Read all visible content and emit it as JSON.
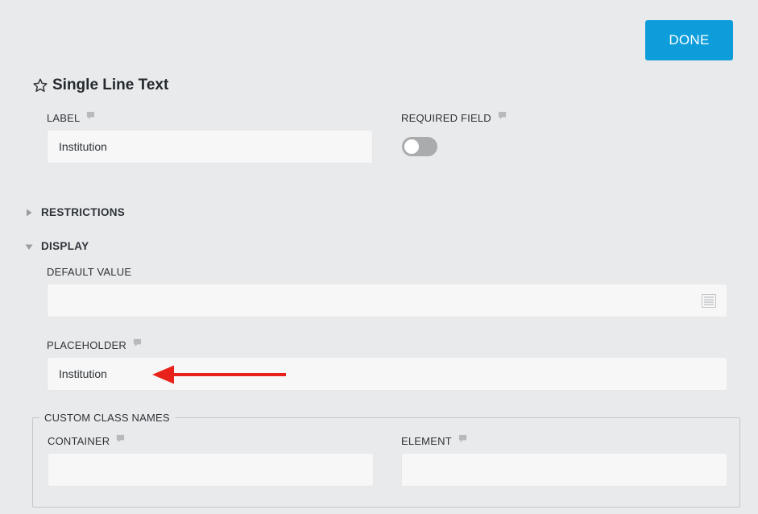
{
  "toolbar": {
    "done_label": "DONE"
  },
  "header": {
    "title": "Single Line Text"
  },
  "fields": {
    "label": {
      "label": "LABEL",
      "value": "Institution"
    },
    "required": {
      "label": "REQUIRED FIELD",
      "on": false
    }
  },
  "sections": {
    "restrictions": {
      "label": "RESTRICTIONS",
      "expanded": false
    },
    "display": {
      "label": "DISPLAY",
      "expanded": true
    }
  },
  "display": {
    "default_value": {
      "label": "DEFAULT VALUE",
      "value": ""
    },
    "placeholder": {
      "label": "PLACEHOLDER",
      "value": "Institution"
    }
  },
  "custom_class_names": {
    "legend": "CUSTOM CLASS NAMES",
    "container": {
      "label": "CONTAINER",
      "value": ""
    },
    "element": {
      "label": "ELEMENT",
      "value": ""
    }
  },
  "colors": {
    "accent": "#0d9ddb",
    "background": "#e9eaec",
    "input_bg": "#f7f7f7",
    "toggle_off": "#a9abad",
    "annotation_arrow": "#e8221b"
  },
  "icons": {
    "favorite": "star-outline-icon",
    "help": "comment-icon",
    "template": "list-icon",
    "collapsed": "caret-right-icon",
    "expanded": "caret-down-icon"
  }
}
